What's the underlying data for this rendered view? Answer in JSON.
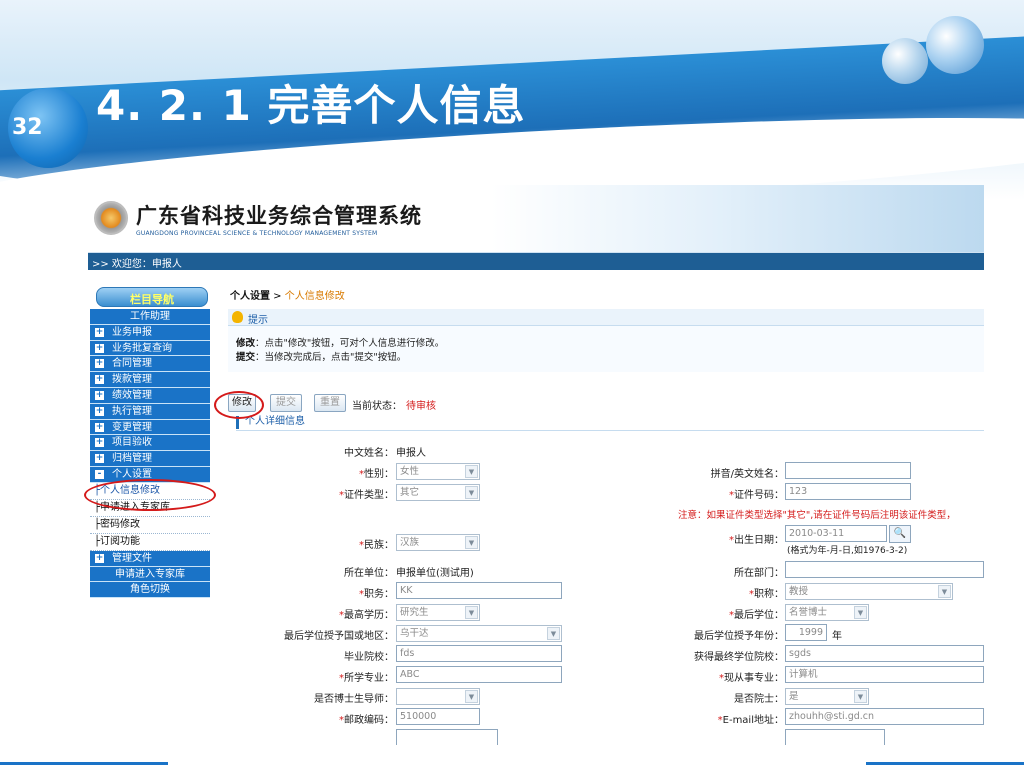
{
  "slide": {
    "page_number": "32",
    "title": "4. 2. 1  完善个人信息"
  },
  "app": {
    "system_title": "广东省科技业务综合管理系统",
    "system_subtitle": "GUANGDONG PROVINCEAL SCIENCE & TECHNOLOGY MANAGEMENT SYSTEM",
    "welcome": ">> 欢迎您：申报人"
  },
  "nav": {
    "header": "栏目导航",
    "items": [
      {
        "label": "工作助理",
        "expandable": false
      },
      {
        "label": "业务申报",
        "expandable": true
      },
      {
        "label": "业务批复查询",
        "expandable": true
      },
      {
        "label": "合同管理",
        "expandable": true
      },
      {
        "label": "拨款管理",
        "expandable": true
      },
      {
        "label": "绩效管理",
        "expandable": true
      },
      {
        "label": "执行管理",
        "expandable": true
      },
      {
        "label": "变更管理",
        "expandable": true
      },
      {
        "label": "项目验收",
        "expandable": true
      },
      {
        "label": "归档管理",
        "expandable": true
      },
      {
        "label": "个人设置",
        "expandable": true,
        "expanded": true
      }
    ],
    "sub_items": [
      "├个人信息修改",
      "├申请进入专家库",
      "├密码修改",
      "├订阅功能"
    ],
    "items_after": [
      {
        "label": "管理文件",
        "expandable": true
      },
      {
        "label": "申请进入专家库",
        "expandable": false
      },
      {
        "label": "角色切换",
        "expandable": false
      }
    ],
    "plus_symbol": "+",
    "minus_symbol": "-"
  },
  "breadcrumb": {
    "root": "个人设置",
    "separator": " > ",
    "current": "个人信息修改"
  },
  "tip": {
    "title": "提示",
    "line1_key": "修改",
    "line1_text": "：点击\"修改\"按钮，可对个人信息进行修改。",
    "line2_key": "提交",
    "line2_text": "：当修改完成后，点击\"提交\"按钮。"
  },
  "actions": {
    "edit_label": "修改",
    "submit_label": "提交",
    "reset_label": "重置",
    "status_label": "当前状态：",
    "status_value": "待审核"
  },
  "section_title": "个人详细信息",
  "form": {
    "chinese_name_label": "中文姓名：",
    "chinese_name_value": "申报人",
    "gender_label": "性别：",
    "gender_value": "女性",
    "pinyin_label": "拼音/英文姓名：",
    "pinyin_value": "",
    "id_type_label": "证件类型：",
    "id_type_value": "其它",
    "id_number_label": "证件号码：",
    "id_number_value": "123",
    "note": "注意：如果证件类型选择\"其它\",请在证件号码后注明该证件类型，",
    "ethnicity_label": "民族：",
    "ethnicity_value": "汉族",
    "birth_label": "出生日期：",
    "birth_value": "2010-03-11",
    "birth_hint": "(格式为年-月-日,如1976-3-2)",
    "unit_label": "所在单位：",
    "unit_value": "申报单位(测试用)",
    "dept_label": "所在部门：",
    "dept_value": "",
    "position_label": "职务：",
    "position_value": "KK",
    "title_label": "职称：",
    "title_value": "教授",
    "education_label": "最高学历：",
    "education_value": "研究生",
    "degree_label": "最后学位：",
    "degree_value": "名誉博士",
    "degree_country_label": "最后学位授予国或地区：",
    "degree_country_value": "乌干达",
    "degree_year_label": "最后学位授予年份：",
    "degree_year_value": "1999",
    "degree_year_unit": "年",
    "school_label": "毕业院校：",
    "school_value": "fds",
    "degree_school_label": "获得最终学位院校：",
    "degree_school_value": "sgds",
    "major_label": "所学专业：",
    "major_value": "ABC",
    "current_major_label": "现从事专业：",
    "current_major_value": "计算机",
    "supervisor_label": "是否博士生导师：",
    "supervisor_value": "",
    "academician_label": "是否院士：",
    "academician_value": "是",
    "postcode_label": "邮政编码：",
    "postcode_value": "510000",
    "email_label": "E-mail地址：",
    "email_value": "zhouhh@sti.gd.cn",
    "required_mark": "*",
    "search_icon_glyph": "🔍"
  },
  "colors": {
    "accent": "#1a73c7",
    "required": "#d41a1a",
    "breadcrumb_current": "#d87a00",
    "header_band": "#1d6fb8"
  }
}
